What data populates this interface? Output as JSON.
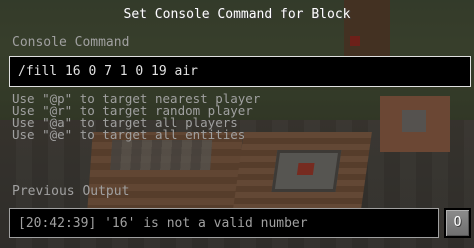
{
  "dialog": {
    "title": "Set Console Command for Block",
    "command_label": "Console Command",
    "command_value": "/fill 16 0 7 1 0 19 air",
    "help_lines": [
      "Use \"@p\" to target nearest player",
      "Use \"@r\" to target random player",
      "Use \"@a\" to target all players",
      "Use \"@e\" to target all entities"
    ],
    "previous_output_label": "Previous Output",
    "previous_output_value": "[20:42:39] '16' is not a valid number",
    "toggle_output_label": "O"
  },
  "colors": {
    "label_gray": "#a0a0a0",
    "field_background": "#000000",
    "text_white": "#ffffff"
  }
}
